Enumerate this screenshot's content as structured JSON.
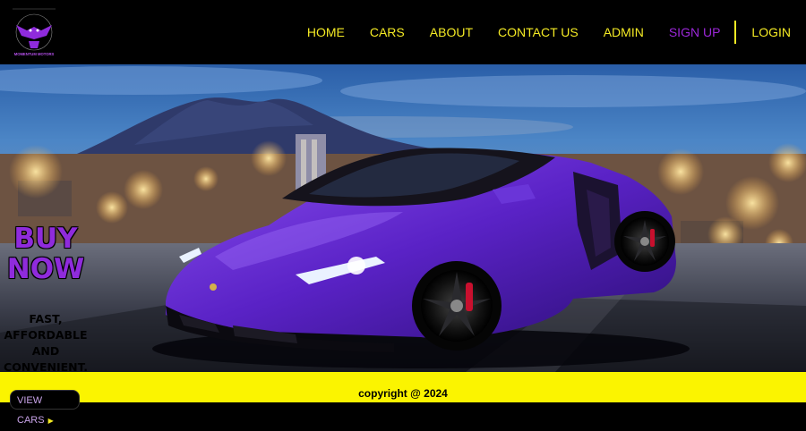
{
  "brand": {
    "logo_text": "MOMENTUM MOTORS",
    "logo_ring_text": "DRIVE YOUR DREAM"
  },
  "nav": {
    "items": [
      {
        "label": "HOME"
      },
      {
        "label": "CARS"
      },
      {
        "label": "ABOUT"
      },
      {
        "label": "CONTACT US"
      },
      {
        "label": "ADMIN"
      },
      {
        "label": "SIGN UP"
      },
      {
        "label": "LOGIN"
      }
    ]
  },
  "hero": {
    "headline": "BUY NOW",
    "tagline": "FAST, AFFORDABLE AND CONVENIENT. GET YOUR DREAM CAR TODAY!"
  },
  "footer": {
    "copyright": "copyright @ 2024",
    "view_cars_label": "VIEW CARS"
  },
  "colors": {
    "accent_yellow": "#f4ea24",
    "accent_purple": "#9b27d8",
    "footer_bg": "#fbf400"
  }
}
